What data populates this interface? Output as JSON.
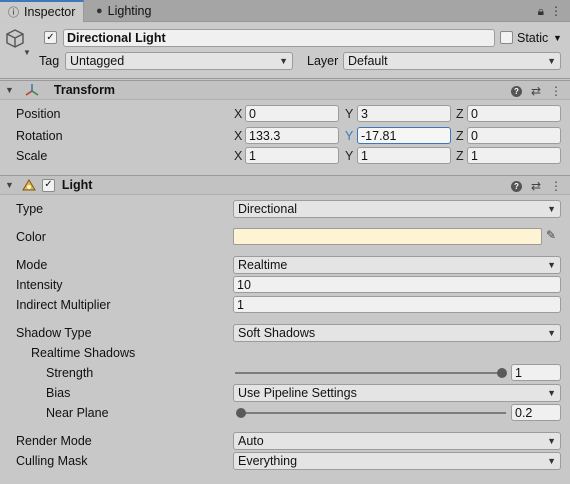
{
  "tabs": {
    "inspector": "Inspector",
    "lighting": "Lighting",
    "inspector_icon": "info-icon",
    "lighting_icon": "bulb-icon"
  },
  "window_controls": {
    "lock_icon": "lock-icon",
    "menu_icon": "kebab-menu-icon"
  },
  "header": {
    "object_name": "Directional Light",
    "active": true,
    "static_label": "Static",
    "static_checked": false,
    "tag_label": "Tag",
    "tag_value": "Untagged",
    "layer_label": "Layer",
    "layer_value": "Default"
  },
  "transform": {
    "title": "Transform",
    "position_label": "Position",
    "rotation_label": "Rotation",
    "scale_label": "Scale",
    "axis_x": "X",
    "axis_y": "Y",
    "axis_z": "Z",
    "position": {
      "x": "0",
      "y": "3",
      "z": "0"
    },
    "rotation": {
      "x": "133.3",
      "y": "-17.81",
      "z": "0"
    },
    "scale": {
      "x": "1",
      "y": "1",
      "z": "1"
    }
  },
  "light": {
    "title": "Light",
    "enabled": true,
    "type_label": "Type",
    "type_value": "Directional",
    "color_label": "Color",
    "color_value": "#fef3d3",
    "mode_label": "Mode",
    "mode_value": "Realtime",
    "intensity_label": "Intensity",
    "intensity_value": "10",
    "indirect_label": "Indirect Multiplier",
    "indirect_value": "1",
    "shadow_type_label": "Shadow Type",
    "shadow_type_value": "Soft Shadows",
    "realtime_shadows_label": "Realtime Shadows",
    "strength_label": "Strength",
    "strength_value": "1",
    "bias_label": "Bias",
    "bias_value": "Use Pipeline Settings",
    "near_plane_label": "Near Plane",
    "near_plane_value": "0.2",
    "render_mode_label": "Render Mode",
    "render_mode_value": "Auto",
    "culling_mask_label": "Culling Mask",
    "culling_mask_value": "Everything"
  },
  "colors": {
    "accent": "#3a79bb",
    "light_color": "#fef3d3"
  }
}
